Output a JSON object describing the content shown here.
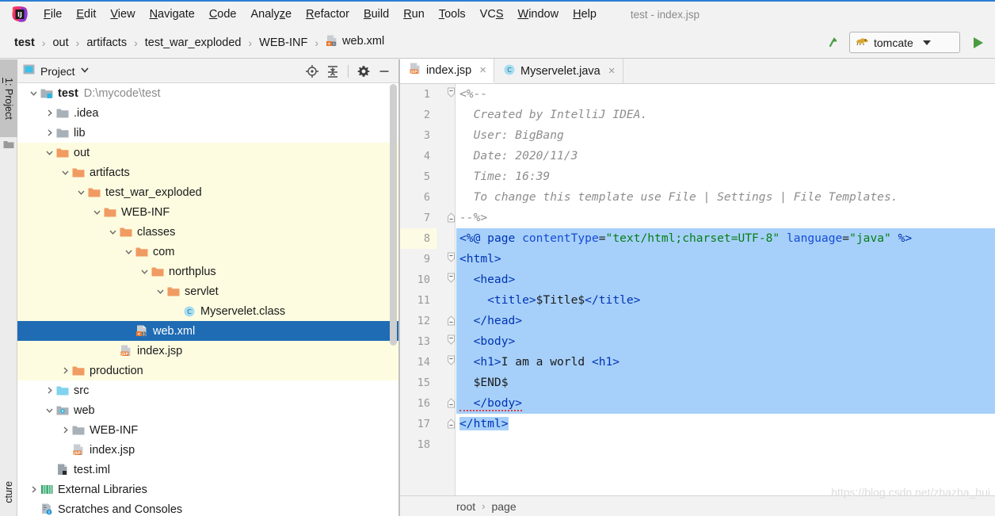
{
  "window": {
    "title": "test - index.jsp",
    "app_icon": "intellij-idea-icon"
  },
  "menubar": {
    "items": [
      {
        "label": "File",
        "mnemonic": "F"
      },
      {
        "label": "Edit",
        "mnemonic": "E"
      },
      {
        "label": "View",
        "mnemonic": "V"
      },
      {
        "label": "Navigate",
        "mnemonic": "N"
      },
      {
        "label": "Code",
        "mnemonic": "C"
      },
      {
        "label": "Analyze",
        "mnemonic": "z"
      },
      {
        "label": "Refactor",
        "mnemonic": "R"
      },
      {
        "label": "Build",
        "mnemonic": "B"
      },
      {
        "label": "Run",
        "mnemonic": "R"
      },
      {
        "label": "Tools",
        "mnemonic": "T"
      },
      {
        "label": "VCS",
        "mnemonic": "S"
      },
      {
        "label": "Window",
        "mnemonic": "W"
      },
      {
        "label": "Help",
        "mnemonic": "H"
      }
    ]
  },
  "navbar": {
    "breadcrumbs": [
      {
        "label": "test",
        "bold": true,
        "icon": null
      },
      {
        "label": "out",
        "bold": false,
        "icon": null
      },
      {
        "label": "artifacts",
        "bold": false,
        "icon": null
      },
      {
        "label": "test_war_exploded",
        "bold": false,
        "icon": null
      },
      {
        "label": "WEB-INF",
        "bold": false,
        "icon": null
      },
      {
        "label": "web.xml",
        "bold": false,
        "icon": "xml-file-icon"
      }
    ],
    "separator": "›",
    "up_arrow_icon": "arrow-up-icon",
    "run_config": {
      "label": "tomcate",
      "icon": "tomcat-icon",
      "dropdown_icon": "chevron-down-icon"
    },
    "run_button_icon": "run-play-icon",
    "accent_green": "#4a9b42"
  },
  "toolstrip": {
    "top_tab": {
      "number": "1",
      "label": "Project",
      "full": "1: Project"
    },
    "bottom_tab": {
      "label": "cture"
    },
    "folder_icon": "folder-icon"
  },
  "project_panel": {
    "header": {
      "title": "Project",
      "view_icon": "project-view-icon",
      "dropdown_icon": "chevron-down-icon",
      "tools": [
        {
          "name": "locate-icon"
        },
        {
          "name": "collapse-all-icon"
        },
        {
          "name": "settings-gear-icon"
        },
        {
          "name": "hide-minimize-icon"
        }
      ]
    },
    "tree": [
      {
        "indent": 0,
        "twisty": "down",
        "icon": "module-folder-icon",
        "label": "test",
        "bold": true,
        "path": "D:\\mycode\\test",
        "bg": "white",
        "selected": false
      },
      {
        "indent": 1,
        "twisty": "right",
        "icon": "folder-gray-icon",
        "label": ".idea",
        "bold": false,
        "path": "",
        "bg": "white",
        "selected": false
      },
      {
        "indent": 1,
        "twisty": "right",
        "icon": "folder-gray-icon",
        "label": "lib",
        "bold": false,
        "path": "",
        "bg": "white",
        "selected": false
      },
      {
        "indent": 1,
        "twisty": "down",
        "icon": "folder-orange-icon",
        "label": "out",
        "bold": false,
        "path": "",
        "bg": "cream",
        "selected": false
      },
      {
        "indent": 2,
        "twisty": "down",
        "icon": "folder-orange-icon",
        "label": "artifacts",
        "bold": false,
        "path": "",
        "bg": "cream",
        "selected": false
      },
      {
        "indent": 3,
        "twisty": "down",
        "icon": "folder-orange-icon",
        "label": "test_war_exploded",
        "bold": false,
        "path": "",
        "bg": "cream",
        "selected": false
      },
      {
        "indent": 4,
        "twisty": "down",
        "icon": "folder-orange-icon",
        "label": "WEB-INF",
        "bold": false,
        "path": "",
        "bg": "cream",
        "selected": false
      },
      {
        "indent": 5,
        "twisty": "down",
        "icon": "folder-orange-icon",
        "label": "classes",
        "bold": false,
        "path": "",
        "bg": "cream",
        "selected": false
      },
      {
        "indent": 6,
        "twisty": "down",
        "icon": "folder-orange-icon",
        "label": "com",
        "bold": false,
        "path": "",
        "bg": "cream",
        "selected": false
      },
      {
        "indent": 7,
        "twisty": "down",
        "icon": "folder-orange-icon",
        "label": "northplus",
        "bold": false,
        "path": "",
        "bg": "cream",
        "selected": false
      },
      {
        "indent": 8,
        "twisty": "down",
        "icon": "folder-orange-icon",
        "label": "servlet",
        "bold": false,
        "path": "",
        "bg": "cream",
        "selected": false
      },
      {
        "indent": 9,
        "twisty": "none",
        "icon": "java-class-icon",
        "label": "Myservelet.class",
        "bold": false,
        "path": "",
        "bg": "cream",
        "selected": false
      },
      {
        "indent": 6,
        "twisty": "none",
        "icon": "xml-file-icon",
        "label": "web.xml",
        "bold": false,
        "path": "",
        "bg": "cream",
        "selected": true
      },
      {
        "indent": 5,
        "twisty": "none",
        "icon": "jsp-file-icon",
        "label": "index.jsp",
        "bold": false,
        "path": "",
        "bg": "cream",
        "selected": false
      },
      {
        "indent": 2,
        "twisty": "right",
        "icon": "folder-orange-icon",
        "label": "production",
        "bold": false,
        "path": "",
        "bg": "cream",
        "selected": false
      },
      {
        "indent": 1,
        "twisty": "right",
        "icon": "folder-blue-icon",
        "label": "src",
        "bold": false,
        "path": "",
        "bg": "white",
        "selected": false
      },
      {
        "indent": 1,
        "twisty": "down",
        "icon": "folder-web-icon",
        "label": "web",
        "bold": false,
        "path": "",
        "bg": "white",
        "selected": false
      },
      {
        "indent": 2,
        "twisty": "right",
        "icon": "folder-gray-icon",
        "label": "WEB-INF",
        "bold": false,
        "path": "",
        "bg": "white",
        "selected": false
      },
      {
        "indent": 2,
        "twisty": "none",
        "icon": "jsp-file-icon",
        "label": "index.jsp",
        "bold": false,
        "path": "",
        "bg": "white",
        "selected": false
      },
      {
        "indent": 1,
        "twisty": "none",
        "icon": "iml-file-icon",
        "label": "test.iml",
        "bold": false,
        "path": "",
        "bg": "white",
        "selected": false
      },
      {
        "indent": 0,
        "twisty": "right",
        "icon": "libraries-icon",
        "label": "External Libraries",
        "bold": false,
        "path": "",
        "bg": "white",
        "selected": false
      },
      {
        "indent": 0,
        "twisty": "none",
        "icon": "scratches-icon",
        "label": "Scratches and Consoles",
        "bold": false,
        "path": "",
        "bg": "white",
        "selected": false
      }
    ]
  },
  "editor": {
    "tabs": [
      {
        "label": "index.jsp",
        "icon": "jsp-file-icon",
        "active": true,
        "close_icon": "close-icon"
      },
      {
        "label": "Myservelet.java",
        "icon": "java-class-icon",
        "active": false,
        "close_icon": "close-icon"
      }
    ],
    "caret_line": 8,
    "line_numbers": [
      1,
      2,
      3,
      4,
      5,
      6,
      7,
      8,
      9,
      10,
      11,
      12,
      13,
      14,
      15,
      16,
      17,
      18
    ],
    "code_lines": [
      {
        "n": 1,
        "fold": "start",
        "selected": false,
        "tokens": [
          {
            "t": "<%--",
            "c": "cmt"
          }
        ]
      },
      {
        "n": 2,
        "fold": "none",
        "selected": false,
        "tokens": [
          {
            "t": "  Created by IntelliJ IDEA.",
            "c": "cmt"
          }
        ]
      },
      {
        "n": 3,
        "fold": "none",
        "selected": false,
        "tokens": [
          {
            "t": "  User: BigBang",
            "c": "cmt"
          }
        ]
      },
      {
        "n": 4,
        "fold": "none",
        "selected": false,
        "tokens": [
          {
            "t": "  Date: 2020/11/3",
            "c": "cmt"
          }
        ]
      },
      {
        "n": 5,
        "fold": "none",
        "selected": false,
        "tokens": [
          {
            "t": "  Time: 16:39",
            "c": "cmt"
          }
        ]
      },
      {
        "n": 6,
        "fold": "none",
        "selected": false,
        "tokens": [
          {
            "t": "  To change this template use File | Settings | File Templates.",
            "c": "cmt"
          }
        ]
      },
      {
        "n": 7,
        "fold": "end",
        "selected": false,
        "tokens": [
          {
            "t": "--%>",
            "c": "cmt"
          }
        ]
      },
      {
        "n": 8,
        "fold": "none",
        "selected": true,
        "caret": true,
        "tokens": [
          {
            "t": "<%@ ",
            "c": "tag"
          },
          {
            "t": "page ",
            "c": "jkw"
          },
          {
            "t": "contentType",
            "c": "attr"
          },
          {
            "t": "=",
            "c": "plain"
          },
          {
            "t": "\"text/html;charset=UTF-8\"",
            "c": "str"
          },
          {
            "t": " ",
            "c": "plain"
          },
          {
            "t": "language",
            "c": "attr"
          },
          {
            "t": "=",
            "c": "plain"
          },
          {
            "t": "\"java\"",
            "c": "str"
          },
          {
            "t": " %>",
            "c": "tag"
          }
        ]
      },
      {
        "n": 9,
        "fold": "start",
        "selected": true,
        "tokens": [
          {
            "t": "<html>",
            "c": "tag"
          }
        ]
      },
      {
        "n": 10,
        "fold": "start",
        "selected": true,
        "tokens": [
          {
            "t": "  <head>",
            "c": "tag"
          }
        ]
      },
      {
        "n": 11,
        "fold": "none",
        "selected": true,
        "tokens": [
          {
            "t": "    <title>",
            "c": "tag"
          },
          {
            "t": "$Title$",
            "c": "plain"
          },
          {
            "t": "</title>",
            "c": "tag"
          }
        ]
      },
      {
        "n": 12,
        "fold": "end",
        "selected": true,
        "tokens": [
          {
            "t": "  </head>",
            "c": "tag"
          }
        ]
      },
      {
        "n": 13,
        "fold": "start",
        "selected": true,
        "tokens": [
          {
            "t": "  <body>",
            "c": "tag"
          }
        ]
      },
      {
        "n": 14,
        "fold": "start",
        "selected": true,
        "tokens": [
          {
            "t": "  <h1>",
            "c": "tag"
          },
          {
            "t": "I am a world ",
            "c": "plain"
          },
          {
            "t": "<h1>",
            "c": "tag"
          }
        ]
      },
      {
        "n": 15,
        "fold": "none",
        "selected": true,
        "tokens": [
          {
            "t": "  $END$",
            "c": "plain"
          }
        ]
      },
      {
        "n": 16,
        "fold": "end",
        "selected": true,
        "tokens": [
          {
            "t": "  </body>",
            "c": "tag",
            "error": true
          }
        ]
      },
      {
        "n": 17,
        "fold": "end",
        "selected": true,
        "selected_partial": true,
        "tokens": [
          {
            "t": "</html>",
            "c": "tag"
          }
        ]
      },
      {
        "n": 18,
        "fold": "none",
        "selected": false,
        "tokens": [
          {
            "t": "",
            "c": "plain"
          }
        ]
      }
    ],
    "breadcrumb": {
      "items": [
        "root",
        "page"
      ],
      "separator": "›"
    },
    "selection_color": "#a6d0fa",
    "caret_line_color": "#fdfbe4"
  },
  "watermark": {
    "text": "https://blog.csdn.net/zhazha_hui"
  }
}
